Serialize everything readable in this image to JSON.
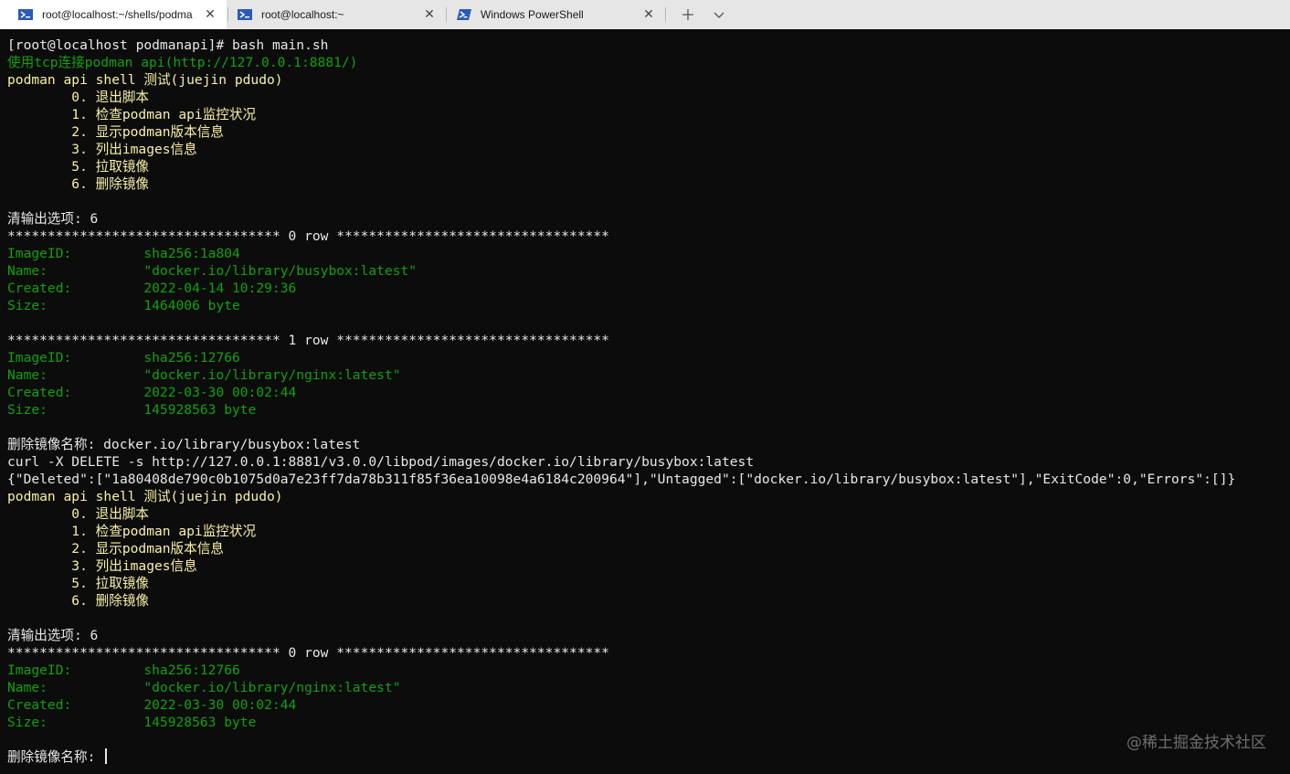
{
  "tabs": [
    {
      "title": "root@localhost:~/shells/podma",
      "active": true
    },
    {
      "title": "root@localhost:~",
      "active": false
    },
    {
      "title": "Windows PowerShell",
      "active": false
    }
  ],
  "tab_actions": {
    "new_tab_icon": "plus-icon",
    "dropdown_icon": "chevron-down-icon"
  },
  "colors": {
    "background": "#0c0c0c",
    "green": "#13a10e",
    "yellow": "#f9f1a5",
    "white": "#e8e8e8"
  },
  "terminal": {
    "lines": [
      {
        "text": "[root@localhost podmanapi]# bash main.sh",
        "color": "white"
      },
      {
        "text": "使用tcp连接podman api(http://127.0.0.1:8881/)",
        "color": "green"
      },
      {
        "text": "podman api shell 测试(juejin pdudo)",
        "color": "yellow"
      },
      {
        "text": "        0. 退出脚本",
        "color": "yellow"
      },
      {
        "text": "        1. 检查podman api监控状况",
        "color": "yellow"
      },
      {
        "text": "        2. 显示podman版本信息",
        "color": "yellow"
      },
      {
        "text": "        3. 列出images信息",
        "color": "yellow"
      },
      {
        "text": "        5. 拉取镜像",
        "color": "yellow"
      },
      {
        "text": "        6. 删除镜像",
        "color": "yellow"
      },
      {
        "text": "",
        "color": "white"
      },
      {
        "text": "清输出选项: 6",
        "color": "white"
      },
      {
        "text": "********************************** 0 row **********************************",
        "color": "white"
      },
      {
        "text": "ImageID:         sha256:1a804",
        "color": "green"
      },
      {
        "text": "Name:            \"docker.io/library/busybox:latest\"",
        "color": "green"
      },
      {
        "text": "Created:         2022-04-14 10:29:36",
        "color": "green"
      },
      {
        "text": "Size:            1464006 byte",
        "color": "green"
      },
      {
        "text": "",
        "color": "white"
      },
      {
        "text": "********************************** 1 row **********************************",
        "color": "white"
      },
      {
        "text": "ImageID:         sha256:12766",
        "color": "green"
      },
      {
        "text": "Name:            \"docker.io/library/nginx:latest\"",
        "color": "green"
      },
      {
        "text": "Created:         2022-03-30 00:02:44",
        "color": "green"
      },
      {
        "text": "Size:            145928563 byte",
        "color": "green"
      },
      {
        "text": "",
        "color": "white"
      },
      {
        "text": "删除镜像名称: docker.io/library/busybox:latest",
        "color": "white"
      },
      {
        "text": "curl -X DELETE -s http://127.0.0.1:8881/v3.0.0/libpod/images/docker.io/library/busybox:latest",
        "color": "white"
      },
      {
        "text": "{\"Deleted\":[\"1a80408de790c0b1075d0a7e23ff7da78b311f85f36ea10098e4a6184c200964\"],\"Untagged\":[\"docker.io/library/busybox:latest\"],\"ExitCode\":0,\"Errors\":[]}",
        "color": "white"
      },
      {
        "text": "podman api shell 测试(juejin pdudo)",
        "color": "yellow"
      },
      {
        "text": "        0. 退出脚本",
        "color": "yellow"
      },
      {
        "text": "        1. 检查podman api监控状况",
        "color": "yellow"
      },
      {
        "text": "        2. 显示podman版本信息",
        "color": "yellow"
      },
      {
        "text": "        3. 列出images信息",
        "color": "yellow"
      },
      {
        "text": "        5. 拉取镜像",
        "color": "yellow"
      },
      {
        "text": "        6. 删除镜像",
        "color": "yellow"
      },
      {
        "text": "",
        "color": "white"
      },
      {
        "text": "清输出选项: 6",
        "color": "white"
      },
      {
        "text": "********************************** 0 row **********************************",
        "color": "white"
      },
      {
        "text": "ImageID:         sha256:12766",
        "color": "green"
      },
      {
        "text": "Name:            \"docker.io/library/nginx:latest\"",
        "color": "green"
      },
      {
        "text": "Created:         2022-03-30 00:02:44",
        "color": "green"
      },
      {
        "text": "Size:            145928563 byte",
        "color": "green"
      },
      {
        "text": "",
        "color": "white"
      }
    ],
    "prompt": "删除镜像名称: "
  },
  "watermark": "@稀土掘金技术社区"
}
